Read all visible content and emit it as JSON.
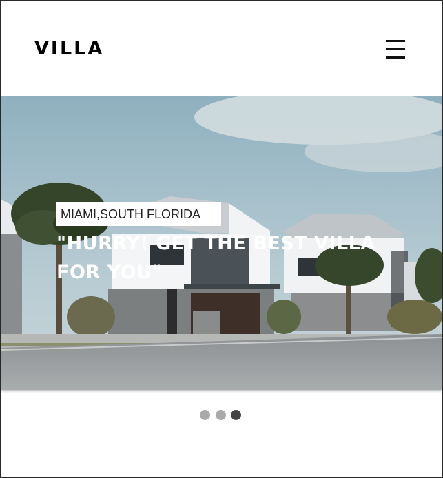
{
  "header": {
    "logo": "VILLA",
    "menu_icon": "hamburger-menu-icon"
  },
  "hero": {
    "location": "MIAMI,SOUTH FLORIDA",
    "headline": "\"HURRY! GET THE BEST VILLA FOR YOU\"",
    "image": "villa-photo"
  },
  "carousel": {
    "slide_count": 3,
    "active_index": 3
  },
  "colors": {
    "dot_inactive": "#aaaaaa",
    "dot_active": "#444444",
    "sky": "#9fb8c3"
  }
}
